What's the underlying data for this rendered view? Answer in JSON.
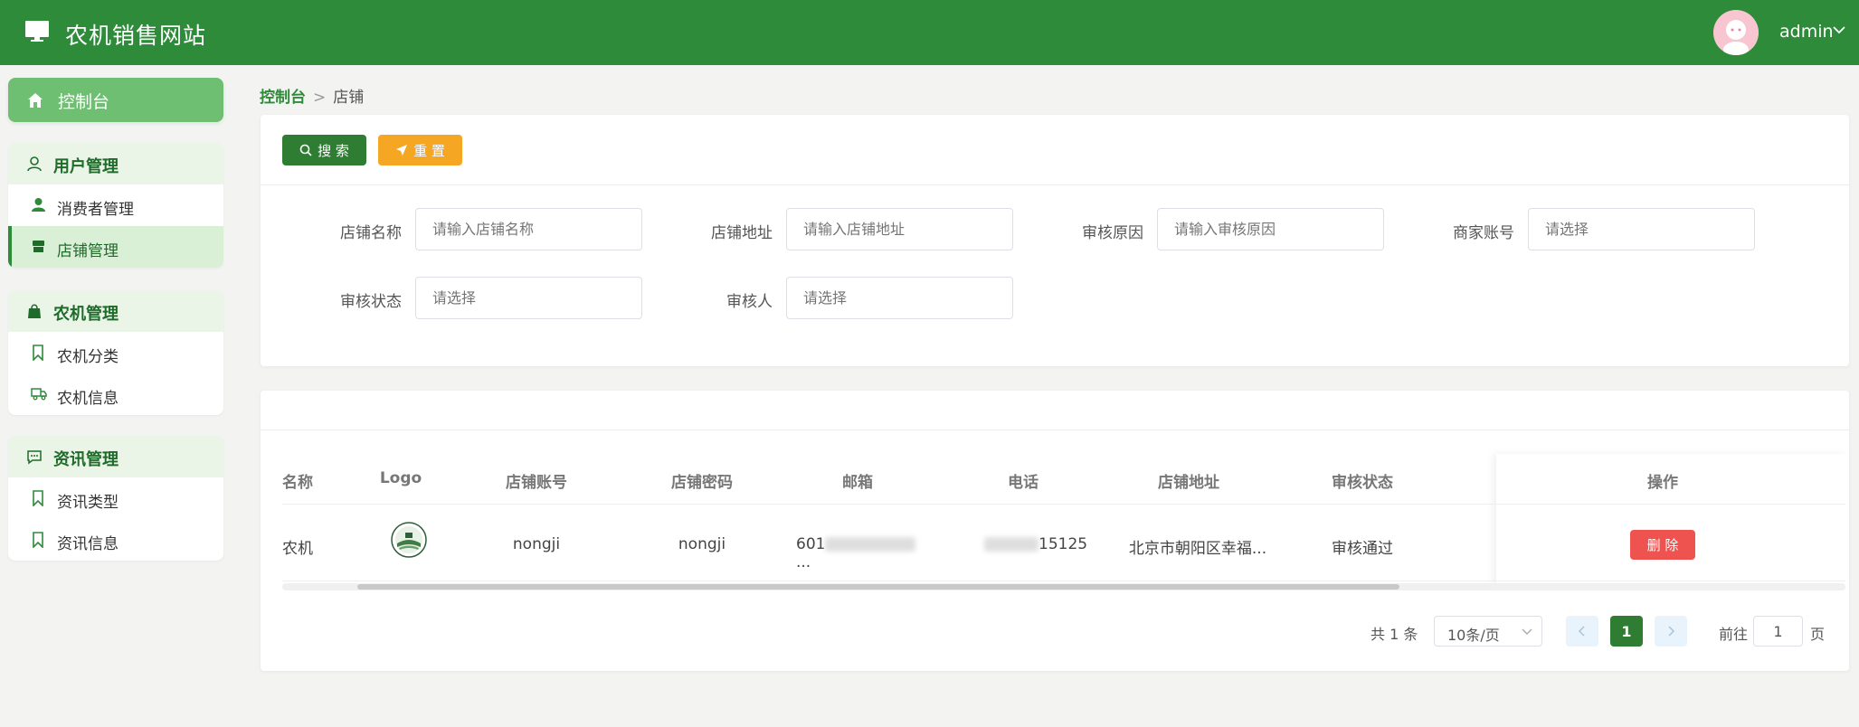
{
  "header": {
    "title": "农机销售网站",
    "username": "admin",
    "brand_color": "#2e8b3a"
  },
  "sidebar": {
    "home_label": "控制台",
    "groups": [
      {
        "label": "用户管理",
        "items": [
          {
            "label": "消费者管理"
          },
          {
            "label": "店铺管理",
            "active": true
          }
        ]
      },
      {
        "label": "农机管理",
        "items": [
          {
            "label": "农机分类"
          },
          {
            "label": "农机信息"
          }
        ]
      },
      {
        "label": "资讯管理",
        "items": [
          {
            "label": "资讯类型"
          },
          {
            "label": "资讯信息"
          }
        ]
      }
    ]
  },
  "breadcrumb": {
    "home": "控制台",
    "current": "店铺"
  },
  "search": {
    "search_button": "搜 索",
    "reset_button": "重 置",
    "fields": [
      {
        "label": "店铺名称",
        "placeholder": "请输入店铺名称"
      },
      {
        "label": "店铺地址",
        "placeholder": "请输入店铺地址"
      },
      {
        "label": "审核原因",
        "placeholder": "请输入审核原因"
      },
      {
        "label": "商家账号",
        "placeholder": "请选择"
      },
      {
        "label": "审核状态",
        "placeholder": "请选择"
      },
      {
        "label": "审核人",
        "placeholder": "请选择"
      }
    ]
  },
  "table": {
    "columns": [
      "名称",
      "Logo",
      "店铺账号",
      "店铺密码",
      "邮箱",
      "电话",
      "店铺地址",
      "审核状态",
      "操作"
    ],
    "rows": [
      {
        "name": "农机",
        "account": "nongji",
        "password": "nongji",
        "email_visible": "601",
        "email_tail": "...",
        "phone_visible": "15125",
        "address": "北京市朝阳区幸福...",
        "status": "审核通过",
        "action": "删 除"
      }
    ]
  },
  "pagination": {
    "total": "共 1 条",
    "page_size": "10条/页",
    "current_page": "1",
    "jump_prefix": "前往",
    "jump_value": "1",
    "jump_suffix": "页"
  }
}
